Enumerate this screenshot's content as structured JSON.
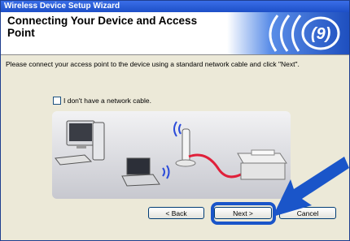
{
  "window": {
    "title": "Wireless Device Setup Wizard"
  },
  "banner": {
    "heading": "Connecting Your Device and Access Point"
  },
  "instruction": "Please connect your access point to the device using a standard network cable and click \"Next\".",
  "checkbox": {
    "label": "I don't have a network cable.",
    "checked": false
  },
  "buttons": {
    "back": "< Back",
    "next": "Next >",
    "cancel": "Cancel"
  },
  "colors": {
    "title_bar": "#1d4fc7",
    "highlight": "#1a55c9",
    "cable": "#e0203a"
  }
}
